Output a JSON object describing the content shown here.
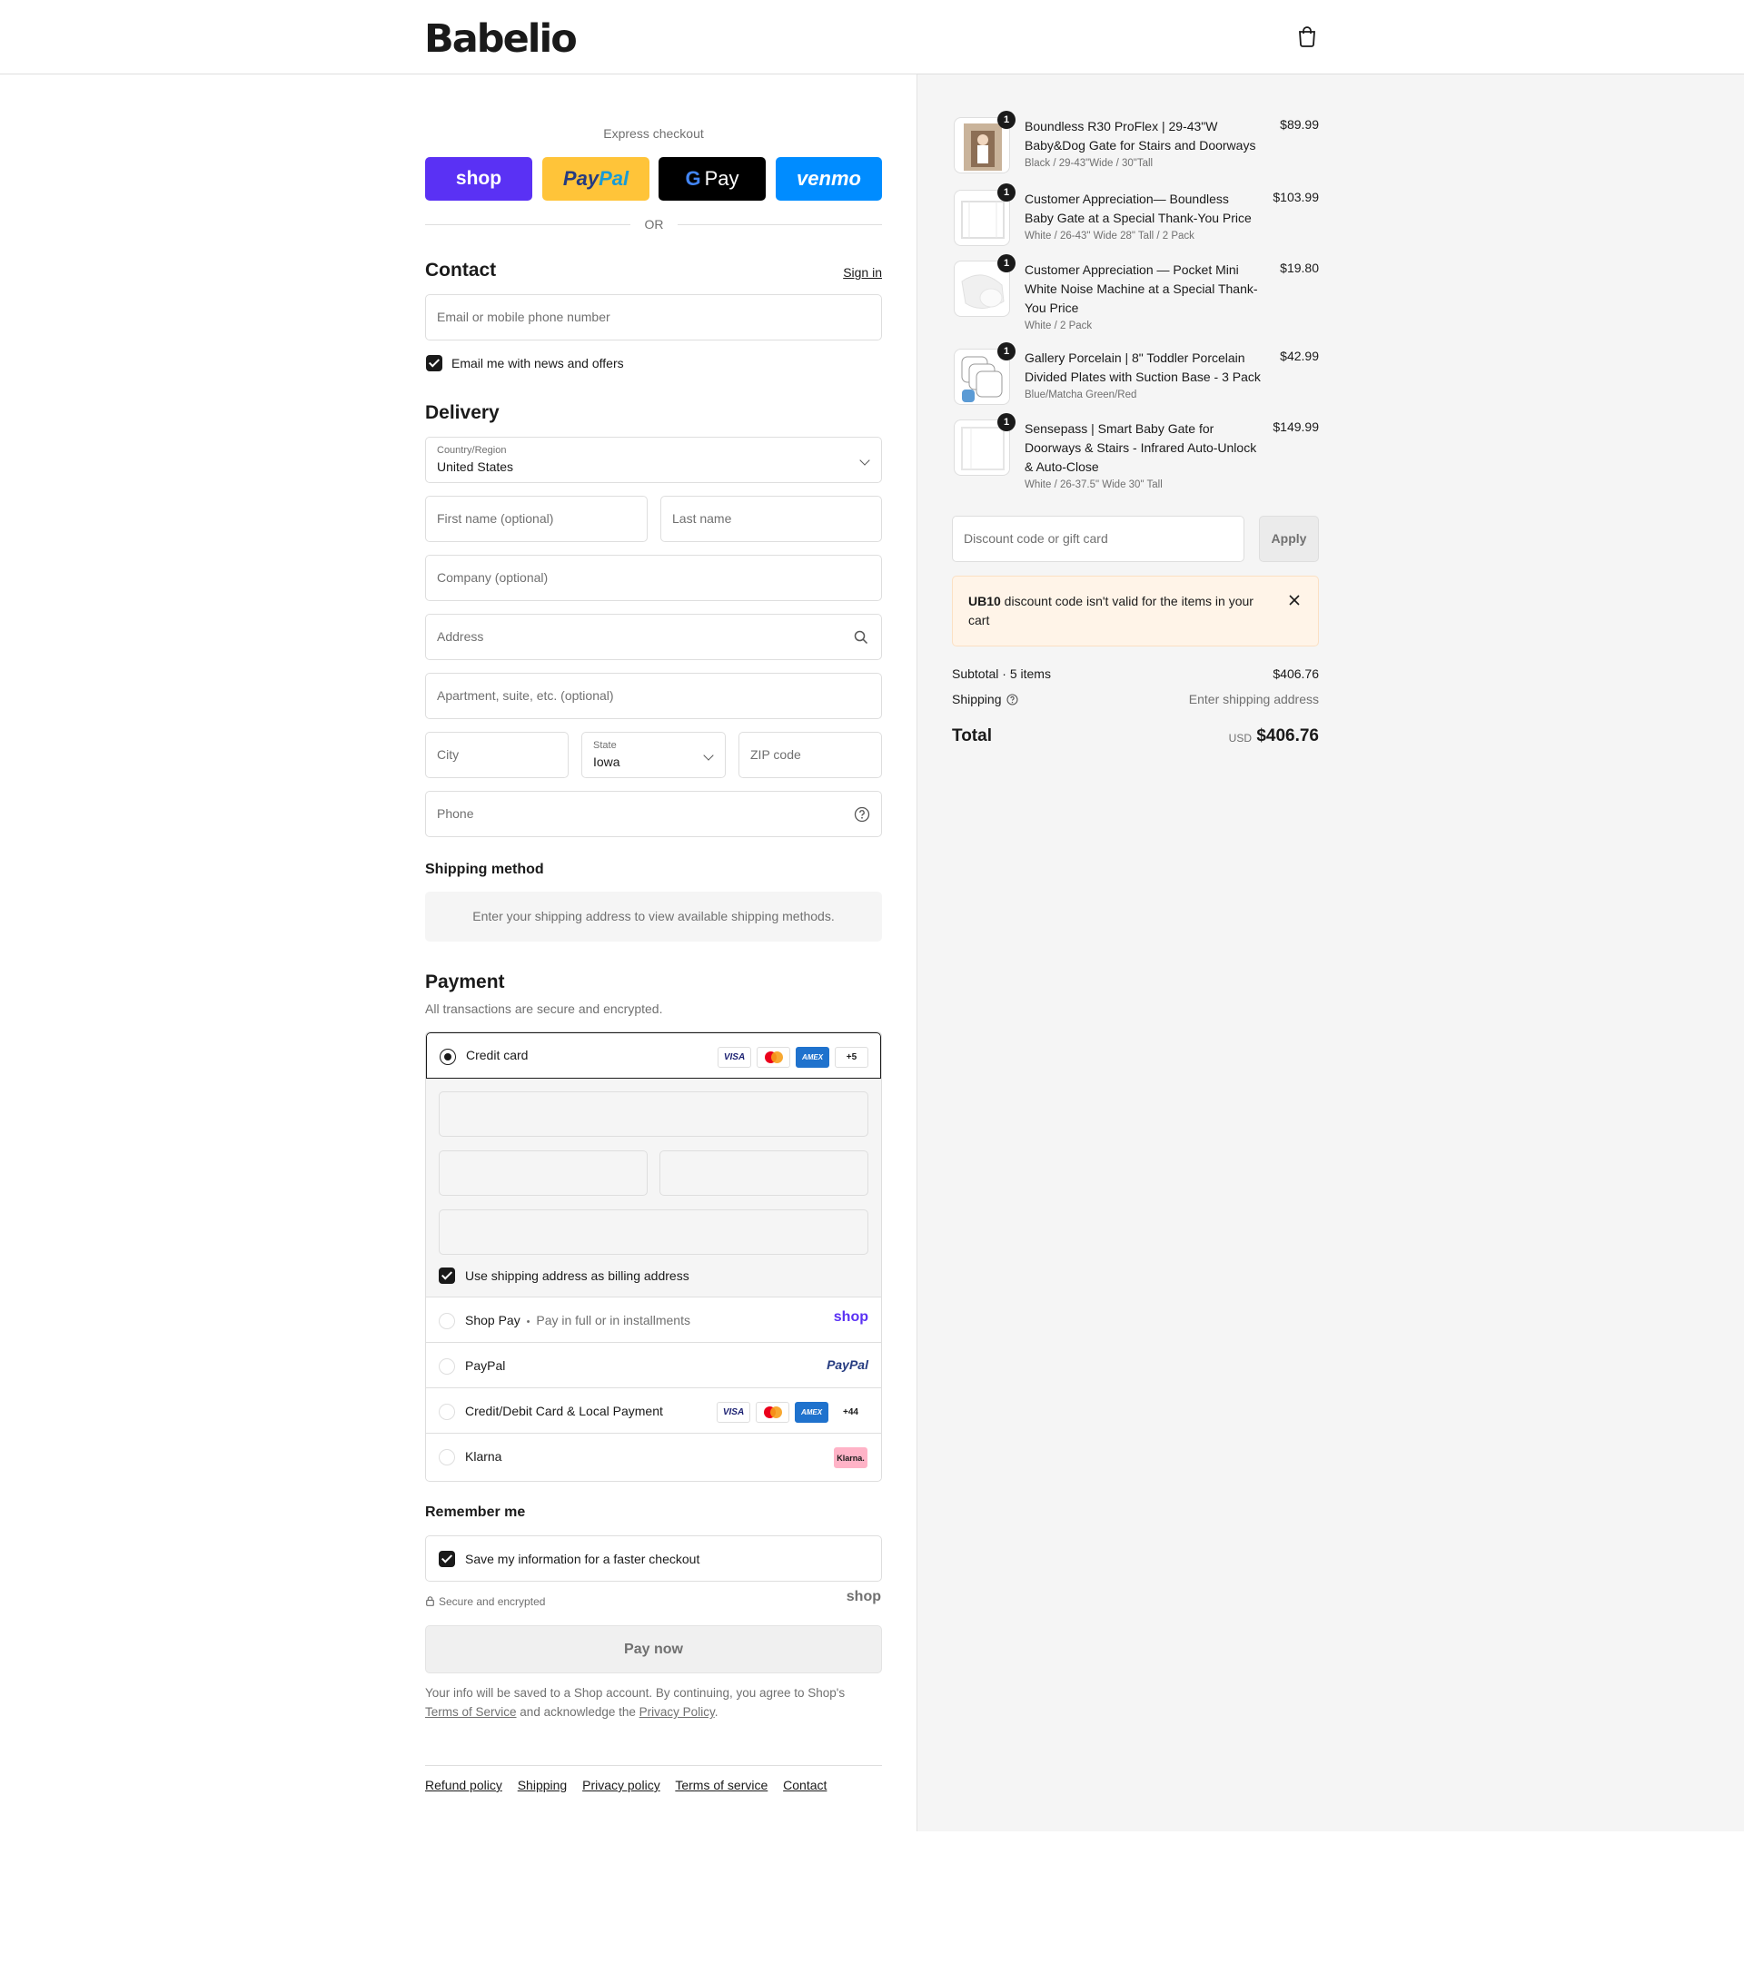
{
  "header": {
    "logo": "Babelio",
    "cart_icon": "shopping-bag-icon"
  },
  "express": {
    "title": "Express checkout",
    "buttons": {
      "shop": "shop",
      "paypal_a": "Pay",
      "paypal_b": "Pal",
      "gpay_g": "G",
      "gpay_pay": "Pay",
      "venmo": "venmo"
    },
    "or": "OR"
  },
  "contact": {
    "title": "Contact",
    "sign_in": "Sign in",
    "email_placeholder": "Email or mobile phone number",
    "newsletter_label": "Email me with news and offers"
  },
  "delivery": {
    "title": "Delivery",
    "country_label": "Country/Region",
    "country_value": "United States",
    "first_name": "First name (optional)",
    "last_name": "Last name",
    "company": "Company (optional)",
    "address": "Address",
    "apartment": "Apartment, suite, etc. (optional)",
    "city": "City",
    "state_label": "State",
    "state_value": "Iowa",
    "zip": "ZIP code",
    "phone": "Phone"
  },
  "shipping_method": {
    "title": "Shipping method",
    "message": "Enter your shipping address to view available shipping methods."
  },
  "payment": {
    "title": "Payment",
    "subtitle": "All transactions are secure and encrypted.",
    "credit_card": "Credit card",
    "card_brands": {
      "visa": "VISA",
      "amex": "AMEX",
      "more": "+5"
    },
    "billing_same": "Use shipping address as billing address",
    "shop_pay": "Shop Pay",
    "shop_pay_sep": "•",
    "shop_pay_sub": "Pay in full or in installments",
    "shop_pay_logo": "shop",
    "paypal": "PayPal",
    "paypal_logo": "PayPal",
    "local": "Credit/Debit Card & Local Payment",
    "local_more": "+44",
    "klarna": "Klarna",
    "klarna_logo": "Klarna."
  },
  "remember": {
    "title": "Remember me",
    "save_label": "Save my information for a faster checkout",
    "secure": "Secure and encrypted",
    "shop_logo": "shop"
  },
  "pay_now": "Pay now",
  "legal": {
    "line1": "Your info will be saved to a Shop account. By continuing, you agree to Shop's",
    "tos": "Terms of Service",
    "mid": "and acknowledge the",
    "privacy": "Privacy Policy",
    "end": "."
  },
  "footer": {
    "links": [
      "Refund policy",
      "Shipping",
      "Privacy policy",
      "Terms of service",
      "Contact"
    ]
  },
  "cart": {
    "items": [
      {
        "qty": "1",
        "name": "Boundless R30 ProFlex | 29-43\"W Baby&Dog Gate for Stairs and Doorways",
        "variant": "Black / 29-43\"Wide / 30\"Tall",
        "price": "$89.99"
      },
      {
        "qty": "1",
        "name": "Customer Appreciation— Boundless Baby Gate at a Special Thank-You Price",
        "variant": "White / 26-43\" Wide 28\" Tall / 2 Pack",
        "price": "$103.99"
      },
      {
        "qty": "1",
        "name": "Customer Appreciation — Pocket Mini White Noise Machine at a Special Thank-You Price",
        "variant": "White / 2 Pack",
        "price": "$19.80"
      },
      {
        "qty": "1",
        "name": "Gallery Porcelain | 8\" Toddler Porcelain Divided Plates with Suction Base - 3 Pack",
        "variant": "Blue/Matcha Green/Red",
        "price": "$42.99"
      },
      {
        "qty": "1",
        "name": "Sensepass | Smart Baby Gate for Doorways & Stairs - Infrared Auto-Unlock & Auto-Close",
        "variant": "White / 26-37.5\" Wide 30\" Tall",
        "price": "$149.99"
      }
    ],
    "discount_placeholder": "Discount code or gift card",
    "apply": "Apply",
    "notice_code": "UB10",
    "notice_text": " discount code isn't valid for the items in your cart",
    "subtotal_label": "Subtotal · 5 items",
    "subtotal_value": "$406.76",
    "shipping_label": "Shipping",
    "shipping_value": "Enter shipping address",
    "total_label": "Total",
    "currency": "USD",
    "total_value": "$406.76"
  },
  "colors": {
    "shop": "#5a31f4",
    "paypal": "#ffc439",
    "venmo": "#008cff",
    "notice_bg": "#fff4e8",
    "summary_bg": "#f5f5f5"
  }
}
